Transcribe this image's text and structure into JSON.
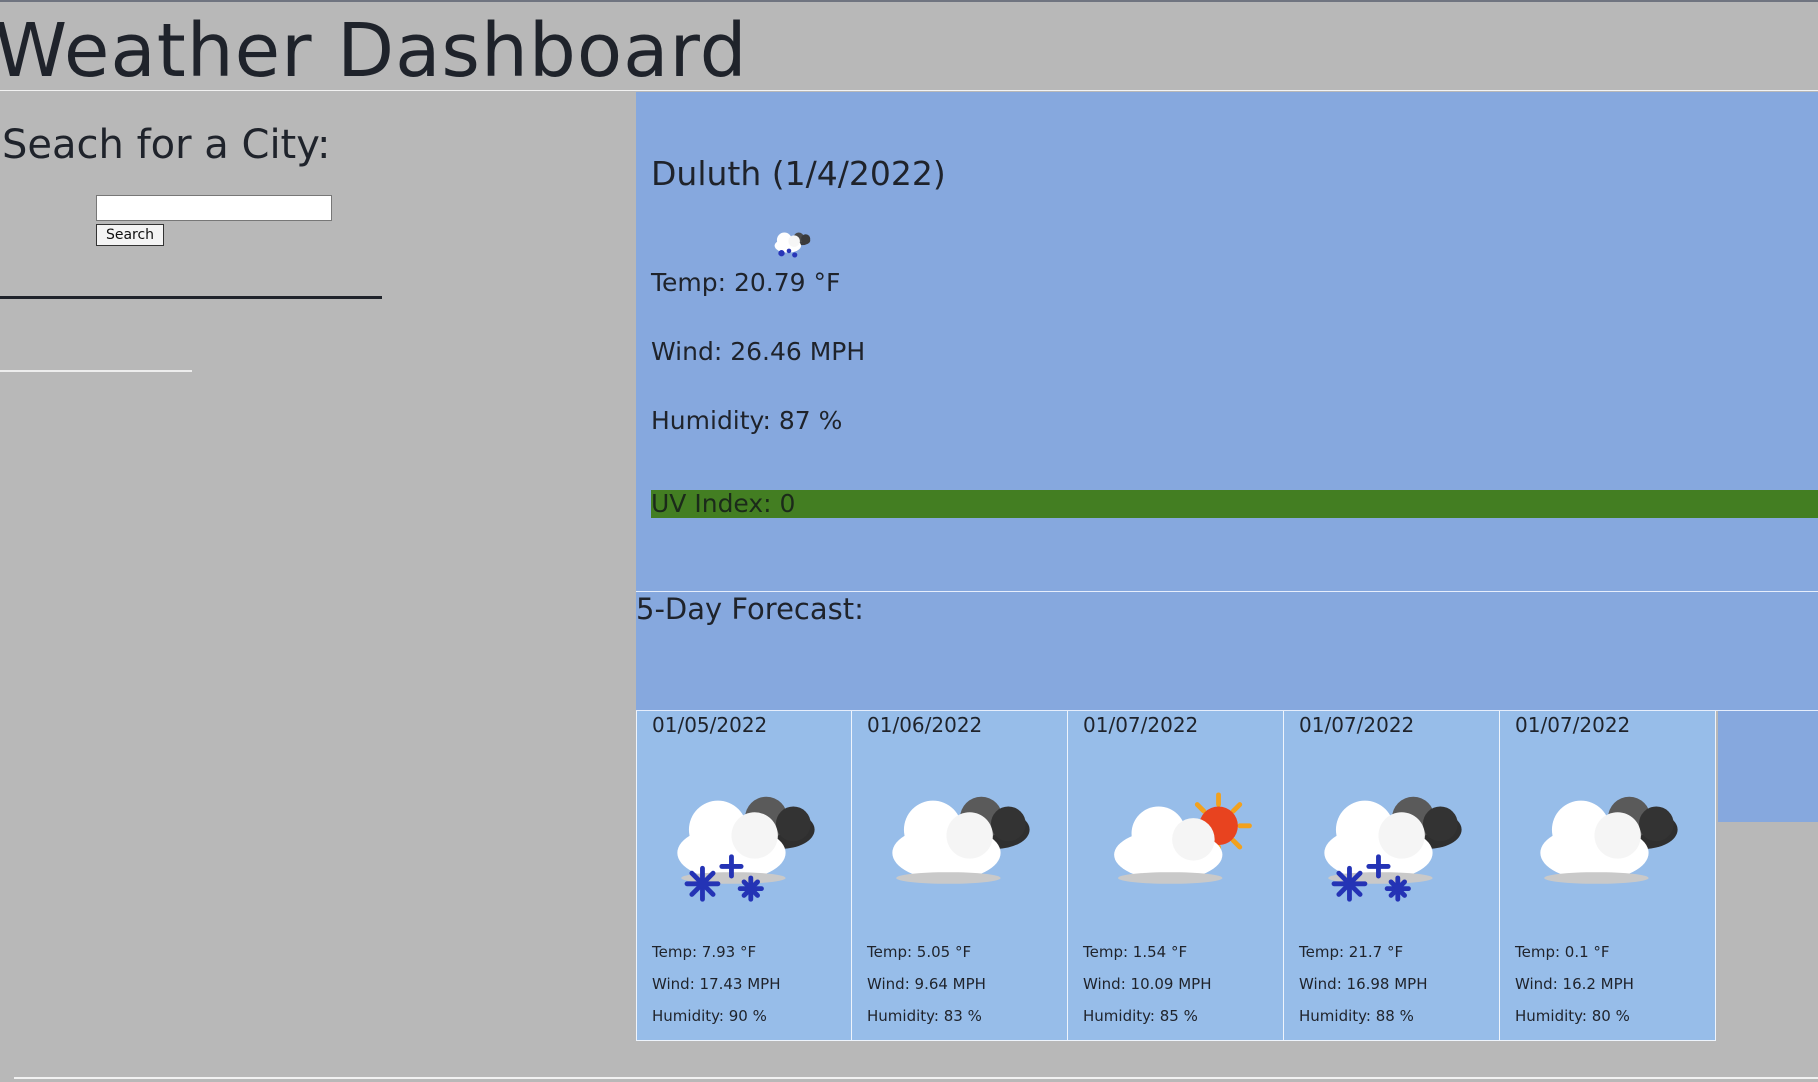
{
  "header": {
    "title": "Weather Dashboard"
  },
  "search": {
    "heading": "Seach for a City:",
    "input_value": "",
    "button_label": "Search"
  },
  "current": {
    "title": "Duluth (1/4/2022)",
    "icon": "snow-cloud-icon",
    "temp": "Temp: 20.79 °F",
    "wind": "Wind: 26.46 MPH",
    "humidity": "Humidity: 87 %",
    "uv": "UV Index: 0",
    "uv_color": "#437e22"
  },
  "forecast": {
    "heading": "5-Day Forecast:",
    "days": [
      {
        "date": "01/05/2022",
        "icon": "snow-cloud-icon",
        "temp": "Temp: 7.93 °F",
        "wind": "Wind: 17.43 MPH",
        "humidity": "Humidity: 90 %"
      },
      {
        "date": "01/06/2022",
        "icon": "cloud-icon",
        "temp": "Temp: 5.05 °F",
        "wind": "Wind: 9.64 MPH",
        "humidity": "Humidity: 83 %"
      },
      {
        "date": "01/07/2022",
        "icon": "sun-cloud-icon",
        "temp": "Temp: 1.54 °F",
        "wind": "Wind: 10.09 MPH",
        "humidity": "Humidity: 85 %"
      },
      {
        "date": "01/07/2022",
        "icon": "snow-cloud-icon",
        "temp": "Temp: 21.7 °F",
        "wind": "Wind: 16.98 MPH",
        "humidity": "Humidity: 88 %"
      },
      {
        "date": "01/07/2022",
        "icon": "cloud-icon",
        "temp": "Temp: 0.1 °F",
        "wind": "Wind: 16.2 MPH",
        "humidity": "Humidity: 80 %"
      }
    ]
  },
  "colors": {
    "page_bg": "#b8b8b8",
    "current_bg": "#86a8de",
    "card_bg": "#97bde9"
  }
}
